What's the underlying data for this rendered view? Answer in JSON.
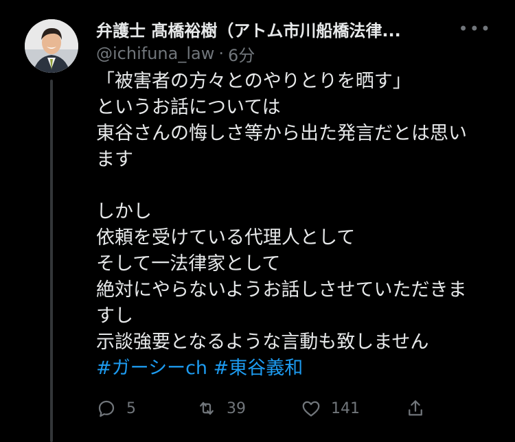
{
  "tweet": {
    "display_name": "弁護士 髙橋裕樹（アトム市川船橋法律...",
    "handle": "@ichifuna_law",
    "separator": "·",
    "timestamp": "6分",
    "more_label": "•••",
    "body_lines": [
      "「被害者の方々とのやりとりを晒す」",
      "というお話については",
      "東谷さんの悔しさ等から出た発言だとは思い",
      "ます",
      "",
      "しかし",
      "依頼を受けている代理人として",
      "そして一法律家として",
      "絶対にやらないようお話しさせていただきま",
      "すし",
      "示談強要となるような言動も致しません"
    ],
    "hashtags": [
      "#ガーシーch",
      "#東谷義和"
    ],
    "actions": {
      "reply_count": "5",
      "retweet_count": "39",
      "like_count": "141"
    }
  },
  "icons": {
    "reply": "reply-icon",
    "retweet": "retweet-icon",
    "like": "heart-icon",
    "share": "share-icon",
    "more": "more-icon"
  },
  "colors": {
    "background": "#000000",
    "text": "#e7e9ea",
    "secondary": "#71767b",
    "link": "#1d9bf0",
    "thread_line": "#333639"
  }
}
